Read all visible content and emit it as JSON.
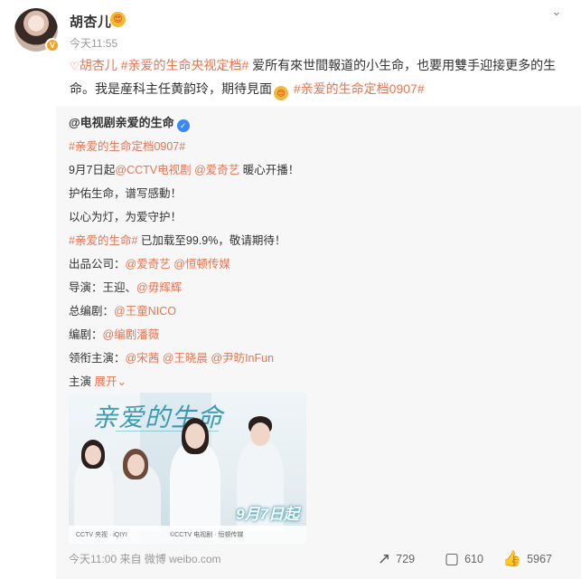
{
  "post": {
    "username": "胡杏儿",
    "time": "今天11:55",
    "text": {
      "heart": "♡",
      "topic1": "胡杏儿",
      "topic2": "#亲爱的生命央视定档#",
      "body1": " 爱所有來世間報道的小生命，也要用雙手迎接更多的生命。我是産科主任黄韵玲，期待見面",
      "topic3": "#亲爱的生命定档0907#"
    }
  },
  "repost": {
    "author": "@电视剧亲爱的生命",
    "lines": [
      {
        "link": "#亲爱的生命定档0907#",
        "text": ""
      },
      {
        "pre": "9月7日起",
        "link": "@CCTV电视剧",
        "mid": " ",
        "link2": "@爱奇艺",
        "text": " 暖心开播！"
      },
      {
        "text": "护佑生命，谱写感動！"
      },
      {
        "text": "以心为灯，为爱守护！"
      },
      {
        "link": "#亲爱的生命#",
        "text": " 已加载至99.9%，敬请期待！"
      },
      {
        "pre": "出品公司：",
        "link": "@爱奇艺",
        "mid": " ",
        "link2": "@恒顿传媒",
        "text": ""
      },
      {
        "pre": "导演：王迎、",
        "link": "@毋辉辉",
        "text": ""
      },
      {
        "pre": "总编剧：",
        "link": "@王童NICO",
        "text": ""
      },
      {
        "pre": "编剧：",
        "link": "@编剧潘薇",
        "text": ""
      },
      {
        "pre": "领衔主演：",
        "link": "@宋茜",
        "mid": " ",
        "link2": "@王晓晨",
        "mid2": " ",
        "link3": "@尹昉InFun",
        "text": ""
      },
      {
        "pre": "主演 ",
        "link": "展开",
        "text": ""
      }
    ],
    "poster": {
      "title": "亲爱的生命",
      "date": "9月7日起",
      "logos": "CCTV 央视 · iQIYI",
      "logos2": "©CCTV 电视剧 · 恒顿传媒"
    },
    "footer": "今天11:00 来自 微博 weibo.com",
    "stats": {
      "repost": "729",
      "comment": "610",
      "like": "5967"
    }
  },
  "colors": {
    "link": "#eb7350",
    "accent": "#f7a31c"
  }
}
